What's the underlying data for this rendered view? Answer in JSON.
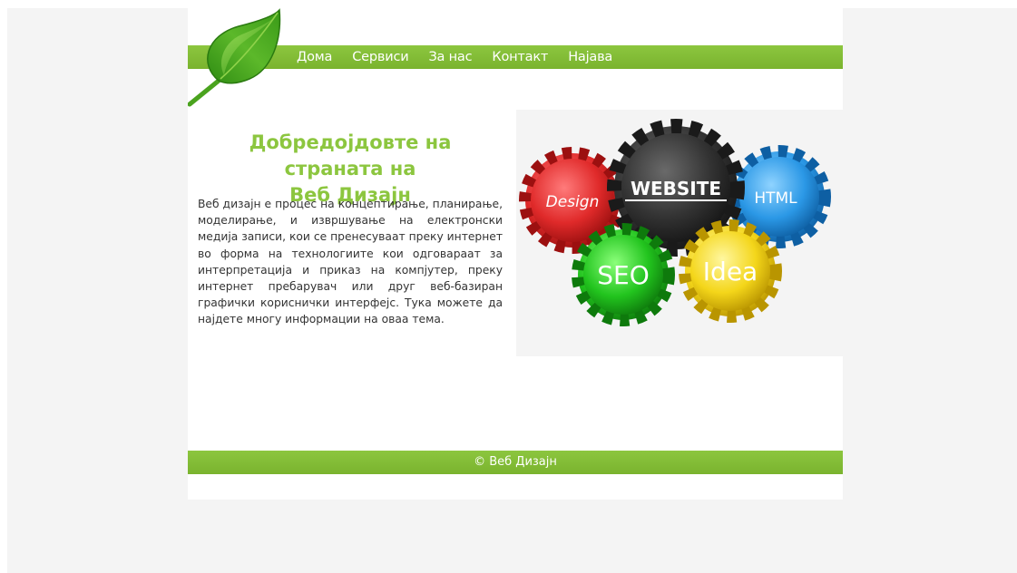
{
  "nav": {
    "items": [
      "Дома",
      "Сервиси",
      "За нас",
      "Контакт",
      "Најава"
    ]
  },
  "hero": {
    "title_line1": "Добредојдовте на страната на",
    "title_line2": "Веб Дизајн",
    "text": "Веб дизајн е процес на концептирање, планирање, моделирање, и извршување на електронски медија записи, кои се пренесуваат преку интернет во форма на технологиите кои одговараат за интерпретација и приказ на компјутер, преку интернет пребарувач или друг веб-базиран графички кориснички интерфејс. Тука можете да најдете многу информации на оваа тема."
  },
  "gears": {
    "website": "WEBSITE",
    "design": "Design",
    "html": "HTML",
    "seo": "SEO",
    "idea": "Idea"
  },
  "footer": {
    "text": "© Веб Дизајн"
  },
  "colors": {
    "accent": "#8cc63f",
    "page_bg": "#f4f4f4",
    "content_bg": "#ffffff",
    "body_text": "#333333"
  },
  "icons": {
    "logo": "leaf-logo-icon"
  }
}
